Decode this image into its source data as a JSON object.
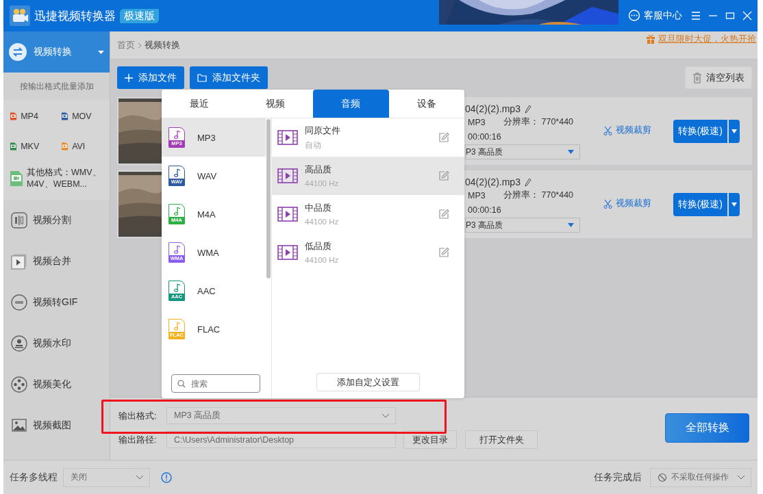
{
  "window": {
    "title": "迅捷视频转换器",
    "edition_badge": "极速版",
    "support": "客服中心"
  },
  "sidebar": {
    "active": {
      "label": "视频转换",
      "expanded": true
    },
    "batch_hint": "按输出格式批量添加",
    "formats": [
      {
        "label": "MP4",
        "color": "#d9542b"
      },
      {
        "label": "MOV",
        "color": "#2d5aa0"
      },
      {
        "label": "MKV",
        "color": "#2e8b4a"
      },
      {
        "label": "AVI",
        "color": "#e98a2c"
      },
      {
        "label": "其他格式：WMV、M4V、WEBM...",
        "color": "#6cbf7a"
      }
    ],
    "tools": [
      {
        "label": "视频分割",
        "kind": "split"
      },
      {
        "label": "视频合并",
        "kind": "merge"
      },
      {
        "label": "视频转GIF",
        "kind": "gif"
      },
      {
        "label": "视频水印",
        "kind": "watermark"
      },
      {
        "label": "视频美化",
        "kind": "beautify"
      },
      {
        "label": "视频截图",
        "kind": "screenshot"
      }
    ]
  },
  "breadcrumb": [
    "首页",
    "视频转换"
  ],
  "promo": "双旦限时大促，火热开抢",
  "toolbar": {
    "add_file": "添加文件",
    "add_folder": "添加文件夹",
    "clear": "清空列表"
  },
  "files": [
    {
      "name": "04(2)(2).mp3",
      "format": "MP3",
      "resolution": "分辨率：  770*440",
      "duration": "00:00:16",
      "output": "P3  高品质",
      "trim": "视频裁剪",
      "convert": "转换(极速)"
    },
    {
      "name": "04(2)(2).mp3",
      "format": "MP3",
      "resolution": "分辨率：  770*440",
      "duration": "00:00:16",
      "output": "P3  高品质",
      "trim": "视频裁剪",
      "convert": "转换(极速)"
    }
  ],
  "format_popup": {
    "tabs": [
      {
        "label": "最近",
        "selected": false
      },
      {
        "label": "视频",
        "selected": false
      },
      {
        "label": "音频",
        "selected": true
      },
      {
        "label": "设备",
        "selected": false
      }
    ],
    "formats": [
      {
        "label": "MP3",
        "badge": "MP3",
        "color": "#a23bb5",
        "selected": true
      },
      {
        "label": "WAV",
        "badge": "WAV",
        "color": "#2d5aa0",
        "selected": false
      },
      {
        "label": "M4A",
        "badge": "M4A",
        "color": "#2fae45",
        "selected": false
      },
      {
        "label": "WMA",
        "badge": "WMA",
        "color": "#8a5cf0",
        "selected": false
      },
      {
        "label": "AAC",
        "badge": "AAC",
        "color": "#17967e",
        "selected": false
      },
      {
        "label": "FLAC",
        "badge": "FLAC",
        "color": "#f5b21f",
        "selected": false
      }
    ],
    "search": {
      "placeholder": "搜索"
    },
    "presets": [
      {
        "name": "同原文件",
        "detail": "自动",
        "selected": false
      },
      {
        "name": "高品质",
        "detail": "44100 Hz",
        "selected": true
      },
      {
        "name": "中品质",
        "detail": "44100 Hz",
        "selected": false
      },
      {
        "name": "低品质",
        "detail": "44100 Hz",
        "selected": false
      }
    ],
    "custom_button": "添加自定义设置"
  },
  "output": {
    "format_label": "输出格式:",
    "format_value": "MP3  高品质",
    "highlighted": true,
    "path_label": "输出路径:",
    "path": "C:\\Users\\Administrator\\Desktop",
    "change_dir": "更改目录",
    "open_folder": "打开文件夹",
    "convert_all": "全部转换"
  },
  "status_bar": {
    "multithread_label": "任务多线程",
    "multithread_value": "关闭",
    "after_label": "任务完成后",
    "after_value": "不采取任何操作"
  }
}
